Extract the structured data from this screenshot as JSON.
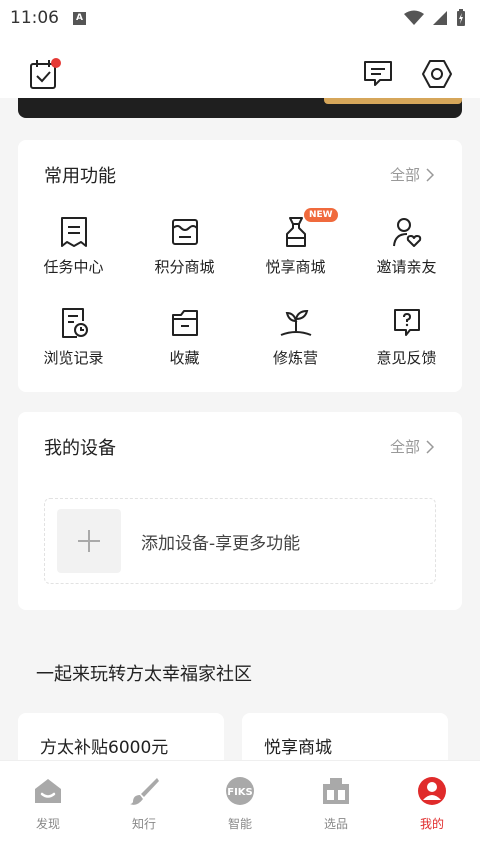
{
  "status_bar": {
    "time": "11:06"
  },
  "header": {
    "calendar_icon": "calendar-check-icon",
    "message_icon": "message-icon",
    "settings_icon": "settings-icon",
    "notification_dot_color": "#e53935"
  },
  "common_functions": {
    "title": "常用功能",
    "all_label": "全部",
    "items": [
      {
        "label": "任务中心",
        "icon": "task-icon"
      },
      {
        "label": "积分商城",
        "icon": "points-store-icon"
      },
      {
        "label": "悦享商城",
        "icon": "spray-bottle-icon",
        "badge": "NEW"
      },
      {
        "label": "邀请亲友",
        "icon": "invite-friends-icon"
      },
      {
        "label": "浏览记录",
        "icon": "history-icon"
      },
      {
        "label": "收藏",
        "icon": "folder-icon"
      },
      {
        "label": "修炼营",
        "icon": "sprout-icon"
      },
      {
        "label": "意见反馈",
        "icon": "feedback-icon"
      }
    ]
  },
  "my_devices": {
    "title": "我的设备",
    "all_label": "全部",
    "add_device_label": "添加设备-享更多功能"
  },
  "community": {
    "title": "一起来玩转方太幸福家社区",
    "cards": [
      {
        "title": "方太补贴6000元"
      },
      {
        "title": "悦享商城"
      }
    ]
  },
  "tab_bar": {
    "active_color": "#e02b2b",
    "tabs": [
      {
        "label": "发现",
        "icon": "discover-icon"
      },
      {
        "label": "知行",
        "icon": "brush-icon"
      },
      {
        "label": "智能",
        "icon": "fiks-icon"
      },
      {
        "label": "选品",
        "icon": "store-icon"
      },
      {
        "label": "我的",
        "icon": "profile-icon",
        "active": true
      }
    ]
  },
  "colors": {
    "accent": "#e02b2b",
    "badge": "#f06a3d"
  }
}
